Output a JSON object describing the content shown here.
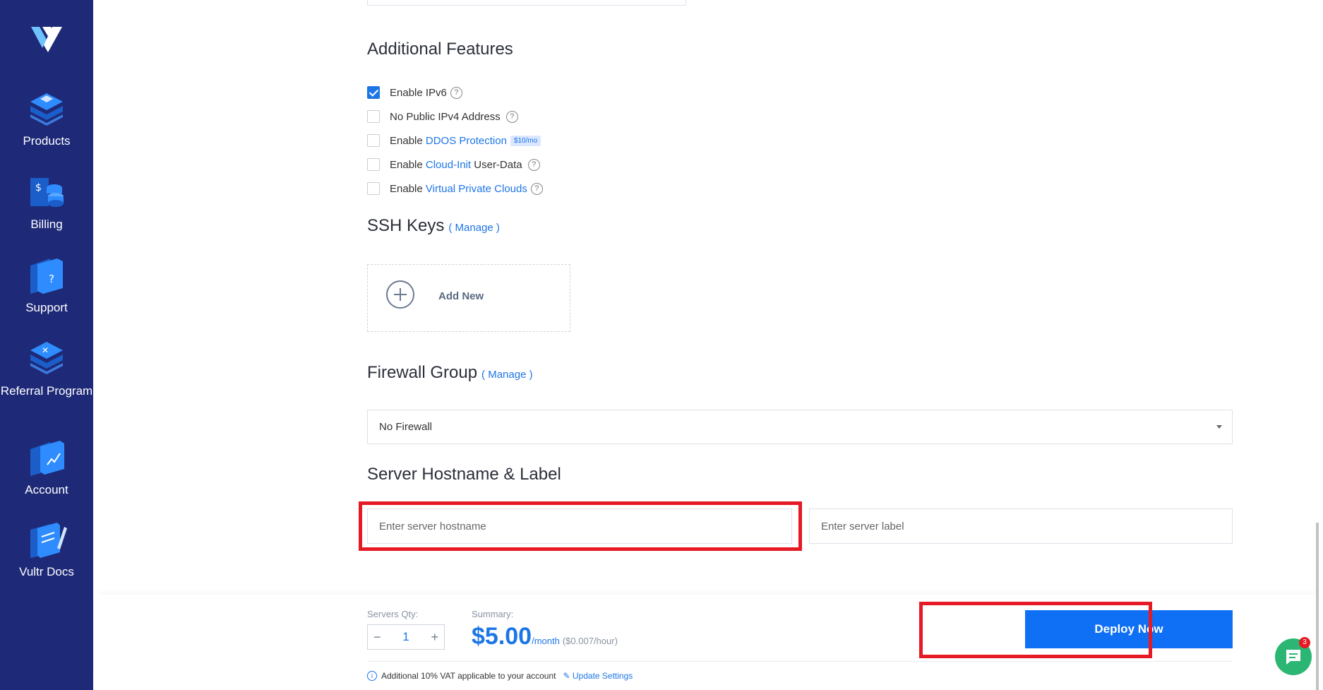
{
  "sidebar": {
    "items": [
      {
        "label": "Products",
        "icon": "products-icon"
      },
      {
        "label": "Billing",
        "icon": "billing-icon"
      },
      {
        "label": "Support",
        "icon": "support-icon"
      },
      {
        "label": "Referral Program",
        "icon": "referral-icon"
      },
      {
        "label": "Account",
        "icon": "account-icon"
      },
      {
        "label": "Vultr Docs",
        "icon": "docs-icon"
      }
    ],
    "colors": {
      "bg": "#1e2a78",
      "accent": "#2f8cff"
    }
  },
  "additional_features": {
    "title": "Additional Features",
    "ipv6": {
      "label": "Enable IPv6",
      "checked": true
    },
    "no_ipv4": {
      "label": "No Public IPv4 Address",
      "checked": false
    },
    "ddos": {
      "prefix": "Enable",
      "link": "DDOS Protection",
      "badge": "$10/mo",
      "checked": false
    },
    "cloud_init": {
      "prefix": "Enable",
      "link": "Cloud-Init",
      "suffix": "User-Data",
      "checked": false
    },
    "vpc": {
      "prefix": "Enable",
      "link": "Virtual Private Clouds",
      "checked": false
    },
    "help_glyph": "?"
  },
  "ssh": {
    "title": "SSH Keys",
    "manage": "( Manage )",
    "add_new": "Add New"
  },
  "firewall": {
    "title": "Firewall Group",
    "manage": "( Manage )",
    "selected": "No Firewall"
  },
  "hostname": {
    "title": "Server Hostname & Label",
    "hostname_placeholder": "Enter server hostname",
    "label_placeholder": "Enter server label"
  },
  "footer": {
    "qty_label": "Servers Qty:",
    "qty_value": "1",
    "qty_minus": "−",
    "qty_plus": "+",
    "summary_label": "Summary:",
    "price": "$5.00",
    "per": "/month",
    "hourly": "($0.007/hour)",
    "deploy": "Deploy Now",
    "vat": "Additional 10% VAT applicable to your account",
    "update": "Update Settings"
  },
  "chat": {
    "badge": "3",
    "icon": "chat-icon"
  }
}
